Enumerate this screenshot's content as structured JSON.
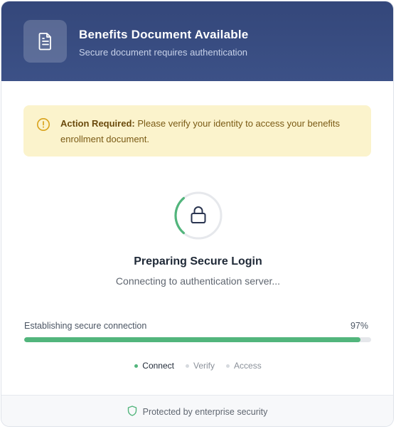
{
  "header": {
    "title": "Benefits Document Available",
    "subtitle": "Secure document requires authentication",
    "icon": "document-icon"
  },
  "alert": {
    "icon": "warning-circle-icon",
    "strong": "Action Required:",
    "text": " Please verify your identity to access your benefits enrollment document."
  },
  "status": {
    "icon": "lock-icon",
    "title": "Preparing Secure Login",
    "subtitle": "Connecting to authentication server..."
  },
  "progress": {
    "label": "Establishing secure connection",
    "percent_label": "97%",
    "value": 97
  },
  "steps": [
    {
      "label": "Connect",
      "state": "active"
    },
    {
      "label": "Verify",
      "state": "pending"
    },
    {
      "label": "Access",
      "state": "pending"
    }
  ],
  "footer": {
    "icon": "shield-icon",
    "text": "Protected by enterprise security"
  },
  "colors": {
    "header": "#3c5187",
    "accent_green": "#52b57c",
    "alert_bg": "#fbf3cc"
  }
}
